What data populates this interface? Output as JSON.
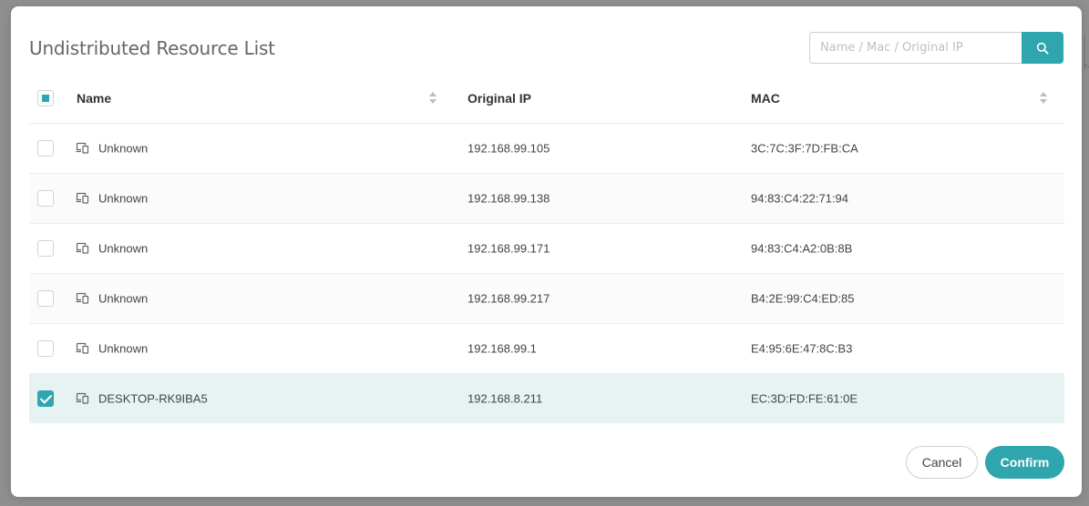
{
  "dialog": {
    "title": "Undistributed Resource List",
    "search_placeholder": "Name / Mac / Original IP",
    "search_value": ""
  },
  "table": {
    "header_checkbox_state": "indeterminate",
    "columns": [
      "Name",
      "Original IP",
      "MAC"
    ],
    "rows": [
      {
        "name": "Unknown",
        "ip": "192.168.99.105",
        "mac": "3C:7C:3F:7D:FB:CA",
        "checked": false,
        "icon": "devices-icon"
      },
      {
        "name": "Unknown",
        "ip": "192.168.99.138",
        "mac": "94:83:C4:22:71:94",
        "checked": false,
        "icon": "devices-icon"
      },
      {
        "name": "Unknown",
        "ip": "192.168.99.171",
        "mac": "94:83:C4:A2:0B:8B",
        "checked": false,
        "icon": "devices-icon"
      },
      {
        "name": "Unknown",
        "ip": "192.168.99.217",
        "mac": "B4:2E:99:C4:ED:85",
        "checked": false,
        "icon": "devices-icon"
      },
      {
        "name": "Unknown",
        "ip": "192.168.99.1",
        "mac": "E4:95:6E:47:8C:B3",
        "checked": false,
        "icon": "devices-icon"
      },
      {
        "name": "DESKTOP-RK9IBA5",
        "ip": "192.168.8.211",
        "mac": "EC:3D:FD:FE:61:0E",
        "checked": true,
        "icon": "devices-icon"
      }
    ]
  },
  "footer": {
    "cancel_label": "Cancel",
    "confirm_label": "Confirm"
  },
  "colors": {
    "accent": "#2fa6ad",
    "selected_row": "#e6f3f2"
  }
}
